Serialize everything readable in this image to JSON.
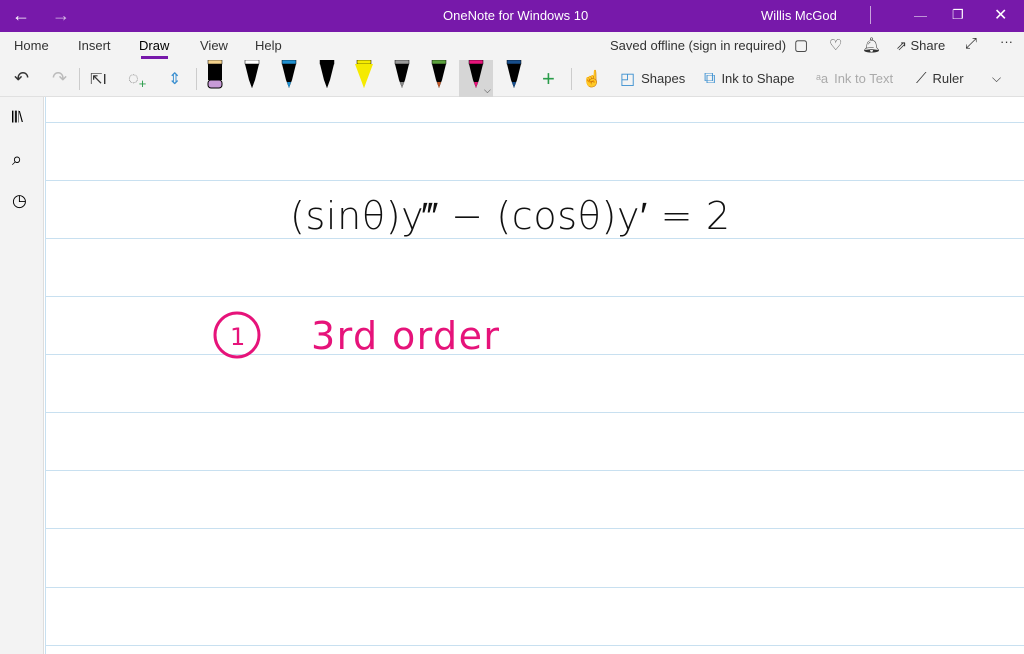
{
  "titlebar": {
    "title": "OneNote for Windows 10",
    "user": "Willis McGod",
    "color": "#7719aa"
  },
  "tabs": [
    {
      "label": "Home"
    },
    {
      "label": "Insert"
    },
    {
      "label": "Draw",
      "active": true
    },
    {
      "label": "View"
    },
    {
      "label": "Help"
    }
  ],
  "status": "Saved offline (sign in required)",
  "share_label": "Share",
  "toolbar": {
    "shapes": "Shapes",
    "ink_to_shape": "Ink to Shape",
    "ink_to_text": "Ink to Text",
    "ruler": "Ruler"
  },
  "pens": [
    {
      "name": "eraser",
      "tip": "#c79ad6",
      "cap": "#f2d08a"
    },
    {
      "name": "pen-black-fine",
      "tip": "#000",
      "cap": "#fff"
    },
    {
      "name": "pen-blue",
      "tip": "#1f8fd0",
      "cap": "#1f8fd0"
    },
    {
      "name": "pen-black",
      "tip": "#000",
      "cap": "#000"
    },
    {
      "name": "highlighter-yellow",
      "tip": "#f5ea00",
      "cap": "#f5ea00"
    },
    {
      "name": "pencil-gray",
      "tip": "#888",
      "cap": "#999"
    },
    {
      "name": "pen-galaxy",
      "tip": "#c0582a",
      "cap": "#5aa03c"
    },
    {
      "name": "pen-pink",
      "tip": "#e6137a",
      "cap": "#e6137a",
      "selected": true
    },
    {
      "name": "pen-navy",
      "tip": "#174e8c",
      "cap": "#174e8c"
    }
  ],
  "ink": {
    "equation": "(sinθ)y‴ − (cosθ)y′ = 2",
    "item_marker": "1",
    "item_text": "3rd order",
    "pink": "#e6137a"
  }
}
